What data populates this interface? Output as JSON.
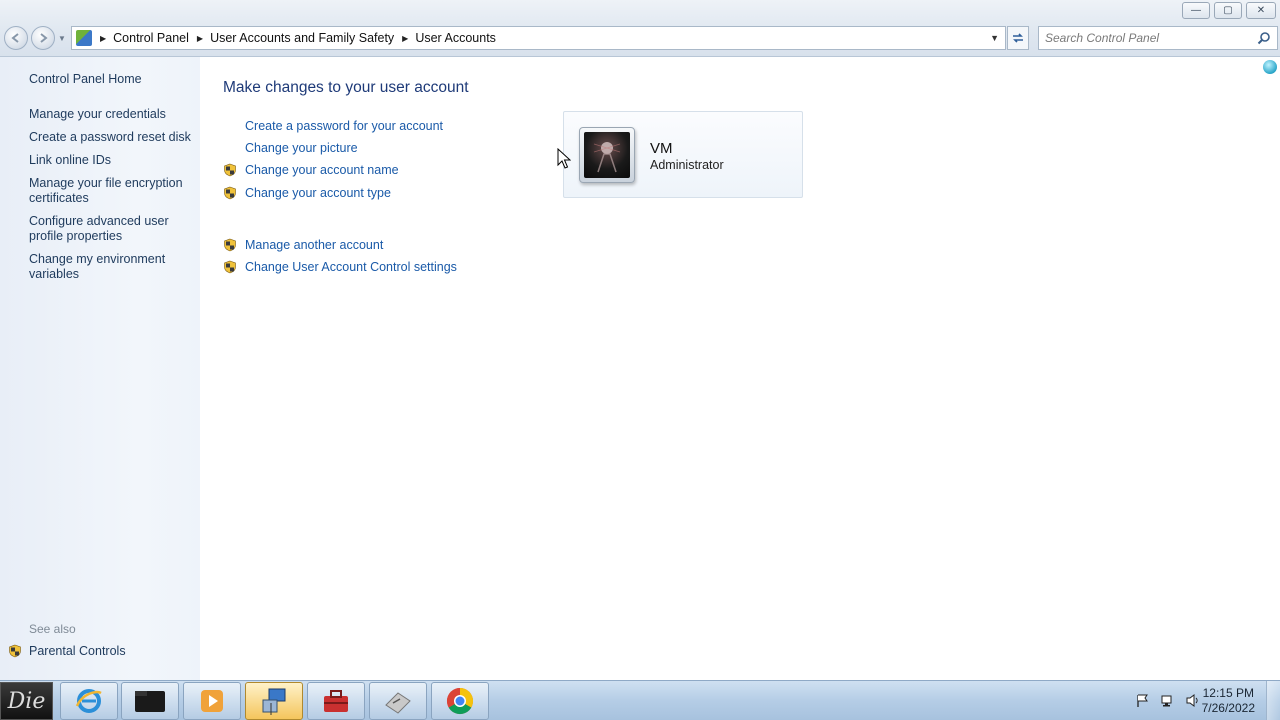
{
  "window": {
    "caption": {
      "minimize": "—",
      "maximize": "▢",
      "close": "✕"
    }
  },
  "navbar": {
    "breadcrumbs": [
      "Control Panel",
      "User Accounts and Family Safety",
      "User Accounts"
    ],
    "search_placeholder": "Search Control Panel"
  },
  "sidebar": {
    "home": "Control Panel Home",
    "links": [
      "Manage your credentials",
      "Create a password reset disk",
      "Link online IDs",
      "Manage your file encryption certificates",
      "Configure advanced user profile properties",
      "Change my environment variables"
    ],
    "see_also_label": "See also",
    "see_also_links": [
      "Parental Controls"
    ]
  },
  "main": {
    "title": "Make changes to your user account",
    "tasks": [
      {
        "label": "Create a password for your account",
        "shield": false
      },
      {
        "label": "Change your picture",
        "shield": false
      },
      {
        "label": "Change your account name",
        "shield": true
      },
      {
        "label": "Change your account type",
        "shield": true
      }
    ],
    "tasks2": [
      {
        "label": "Manage another account",
        "shield": true
      },
      {
        "label": "Change User Account Control settings",
        "shield": true
      }
    ]
  },
  "account": {
    "name": "VM",
    "role": "Administrator"
  },
  "taskbar": {
    "start_label": "Die",
    "apps": [
      "internet-explorer",
      "terminal",
      "media-player",
      "remote-desktop",
      "toolbox",
      "system-tool",
      "chrome"
    ],
    "clock_time": "12:15 PM",
    "clock_date": "7/26/2022"
  }
}
